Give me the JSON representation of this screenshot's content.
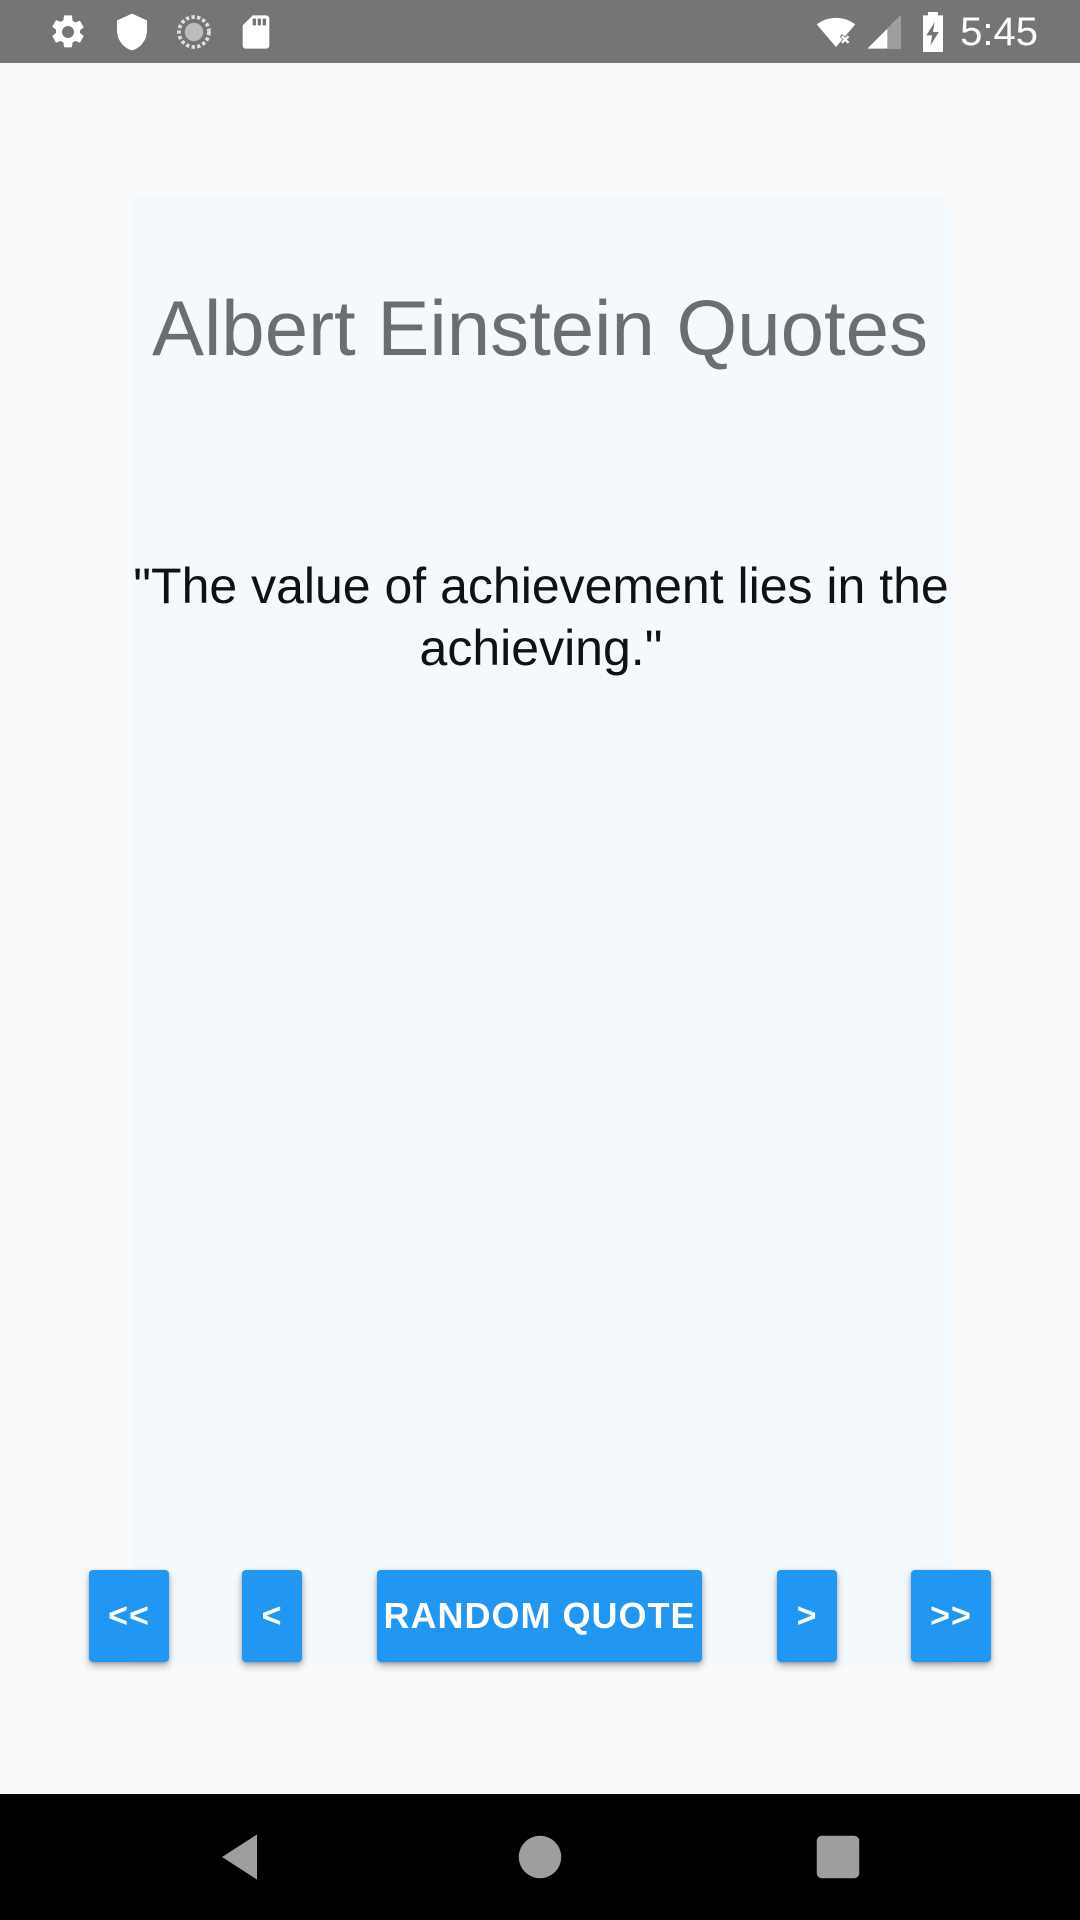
{
  "status_bar": {
    "time": "5:45",
    "left_icons": [
      "gear-icon",
      "shield-icon",
      "sync-icon",
      "sd-card-icon"
    ],
    "right_icons": [
      "wifi-off-icon",
      "signal-icon",
      "battery-charging-icon"
    ]
  },
  "main": {
    "title": "Albert Einstein Quotes",
    "quote": "\"The value of achievement lies in the achieving.\""
  },
  "buttons": {
    "first": "<<",
    "prev": "<",
    "random": "RANDOM QUOTE",
    "next": ">",
    "last": ">>"
  },
  "nav_bar": {
    "icons": [
      "back-icon",
      "home-icon",
      "recents-icon"
    ]
  },
  "colors": {
    "accent": "#2196f3",
    "status_bar": "#757575",
    "card_background": "#f3f9fd",
    "title_text": "#6b6e70"
  }
}
